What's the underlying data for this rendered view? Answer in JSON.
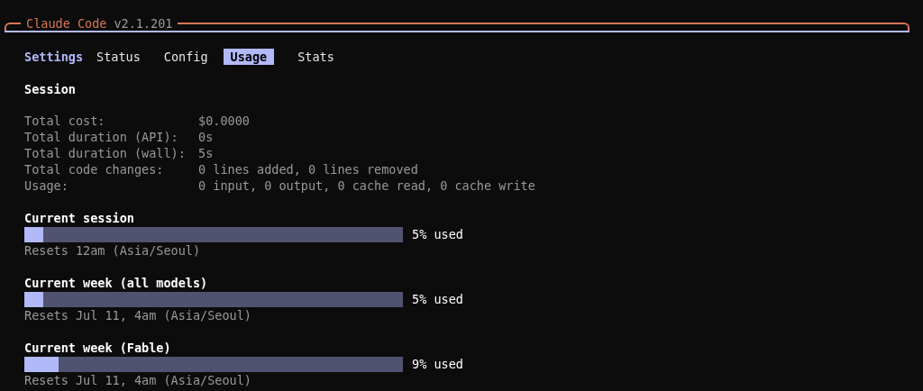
{
  "window": {
    "title": "Claude Code",
    "version": "v2.1.201"
  },
  "heading": "Settings",
  "tabs": [
    {
      "label": "Status",
      "selected": false
    },
    {
      "label": "Config",
      "selected": false
    },
    {
      "label": "Usage",
      "selected": true
    },
    {
      "label": "Stats",
      "selected": false
    }
  ],
  "session": {
    "title": "Session",
    "rows": [
      {
        "label": "Total cost:",
        "value": "$0.0000"
      },
      {
        "label": "Total duration (API):",
        "value": "0s"
      },
      {
        "label": "Total duration (wall):",
        "value": "5s"
      },
      {
        "label": "Total code changes:",
        "value": "0 lines added, 0 lines removed"
      },
      {
        "label": "Usage:",
        "value": "0 input, 0 output, 0 cache read, 0 cache write"
      }
    ]
  },
  "limits": [
    {
      "title": "Current session",
      "level": 0.05,
      "reading": "5% used",
      "resets": "Resets 12am (Asia/Seoul)"
    },
    {
      "title": "Current week (all models)",
      "level": 0.05,
      "reading": "5% used",
      "resets": "Resets Jul 11, 4am (Asia/Seoul)"
    },
    {
      "title": "Current week (Fable)",
      "level": 0.09,
      "reading": "9% used",
      "resets": "Resets Jul 11, 4am (Asia/Seoul)"
    }
  ]
}
